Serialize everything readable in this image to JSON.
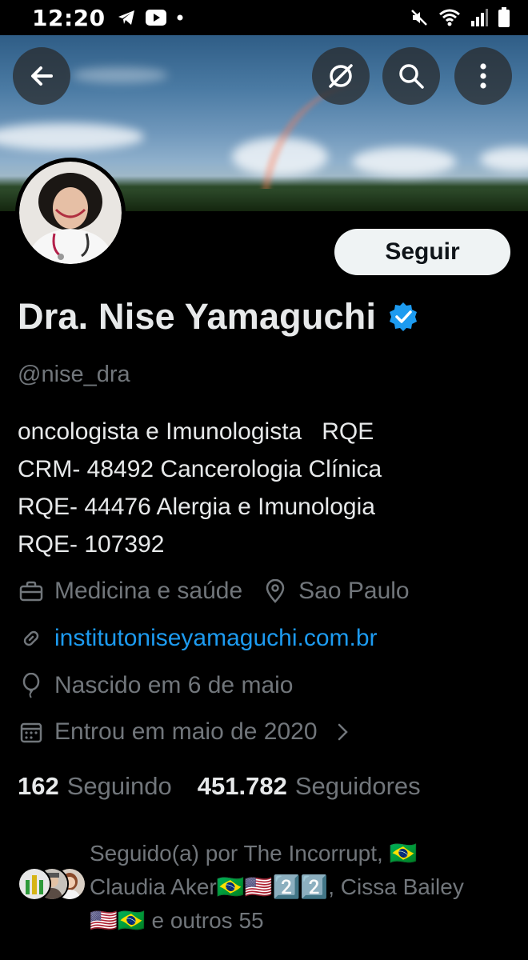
{
  "status_bar": {
    "time": "12:20",
    "icons_left": [
      "telegram-icon",
      "youtube-icon",
      "dot-icon"
    ],
    "icons_right": [
      "mute-icon",
      "wifi-icon",
      "signal-icon",
      "battery-icon"
    ]
  },
  "header": {
    "icons": [
      "back-arrow-icon",
      "grok-icon",
      "search-icon",
      "more-vertical-icon"
    ]
  },
  "profile": {
    "follow_label": "Seguir",
    "display_name": "Dra. Nise Yamaguchi",
    "handle": "@nise_dra",
    "bio_lines": [
      "oncologista e Imunologista   RQE",
      "CRM- 48492 Cancerologia Clínica",
      "RQE- 44476 Alergia e Imunologia",
      "RQE- 107392"
    ],
    "category": "Medicina e saúde",
    "location": "Sao Paulo",
    "website": "institutoniseyamaguchi.com.br",
    "birthday": "Nascido em 6 de maio",
    "joined": "Entrou em maio de 2020",
    "following_count": "162",
    "following_label": "Seguindo",
    "followers_count": "451.782",
    "followers_label": "Seguidores",
    "followed_by_lines": [
      "Seguido(a) por The Incorrupt, 🇧🇷",
      "Claudia Aker🇧🇷🇺🇸2️⃣2️⃣, Cissa Bailey",
      "🇺🇸🇧🇷 e outros 55"
    ]
  },
  "colors": {
    "accent": "#1d9bf0",
    "secondary_text": "#71767b",
    "primary_text": "#e7e9ea",
    "background": "#000000"
  }
}
